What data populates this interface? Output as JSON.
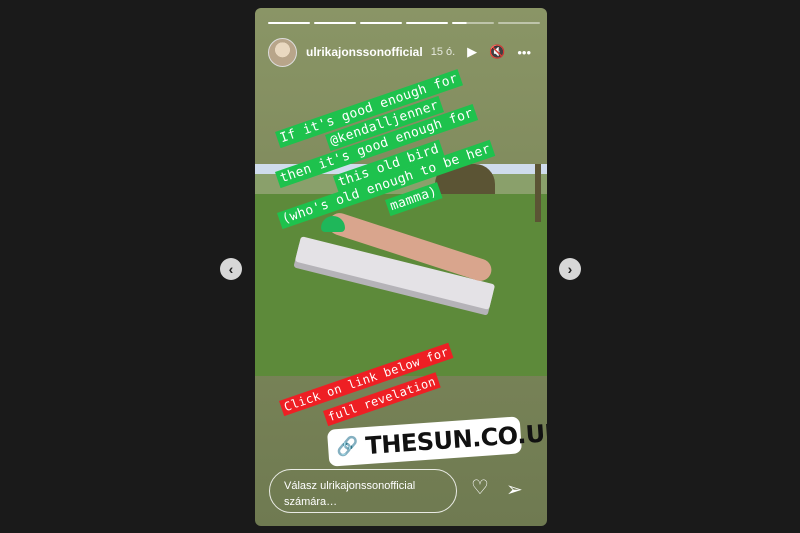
{
  "story": {
    "username": "ulrikajonssonofficial",
    "time": "15 ó.",
    "progress": {
      "segments": 7,
      "completed": 4,
      "current_fraction": 0.35
    },
    "icons": {
      "play": "play-icon",
      "mute": "mute-icon",
      "more": "more-icon"
    },
    "caption_lines": [
      "If it's good enough for",
      "@kendalljenner",
      "then it's good enough for",
      "this old bird",
      "(who's old enough to be her",
      "mamma)"
    ],
    "link_caption_lines": [
      "Click on link below for",
      "full revelation"
    ],
    "link_sticker": {
      "text": "THESUN.CO.UK",
      "icon": "link-icon"
    },
    "reply_placeholder_line1": "Válasz ulrikajonssonofficial",
    "reply_placeholder_line2": "számára…",
    "actions": {
      "like": "heart-icon",
      "share": "send-icon"
    }
  },
  "navigation": {
    "prev": "prev-arrow-icon",
    "next": "next-arrow-icon"
  },
  "colors": {
    "caption_bg": "#1ec24d",
    "link_caption_bg": "#ee1f24",
    "page_bg": "#1a1a1a"
  }
}
